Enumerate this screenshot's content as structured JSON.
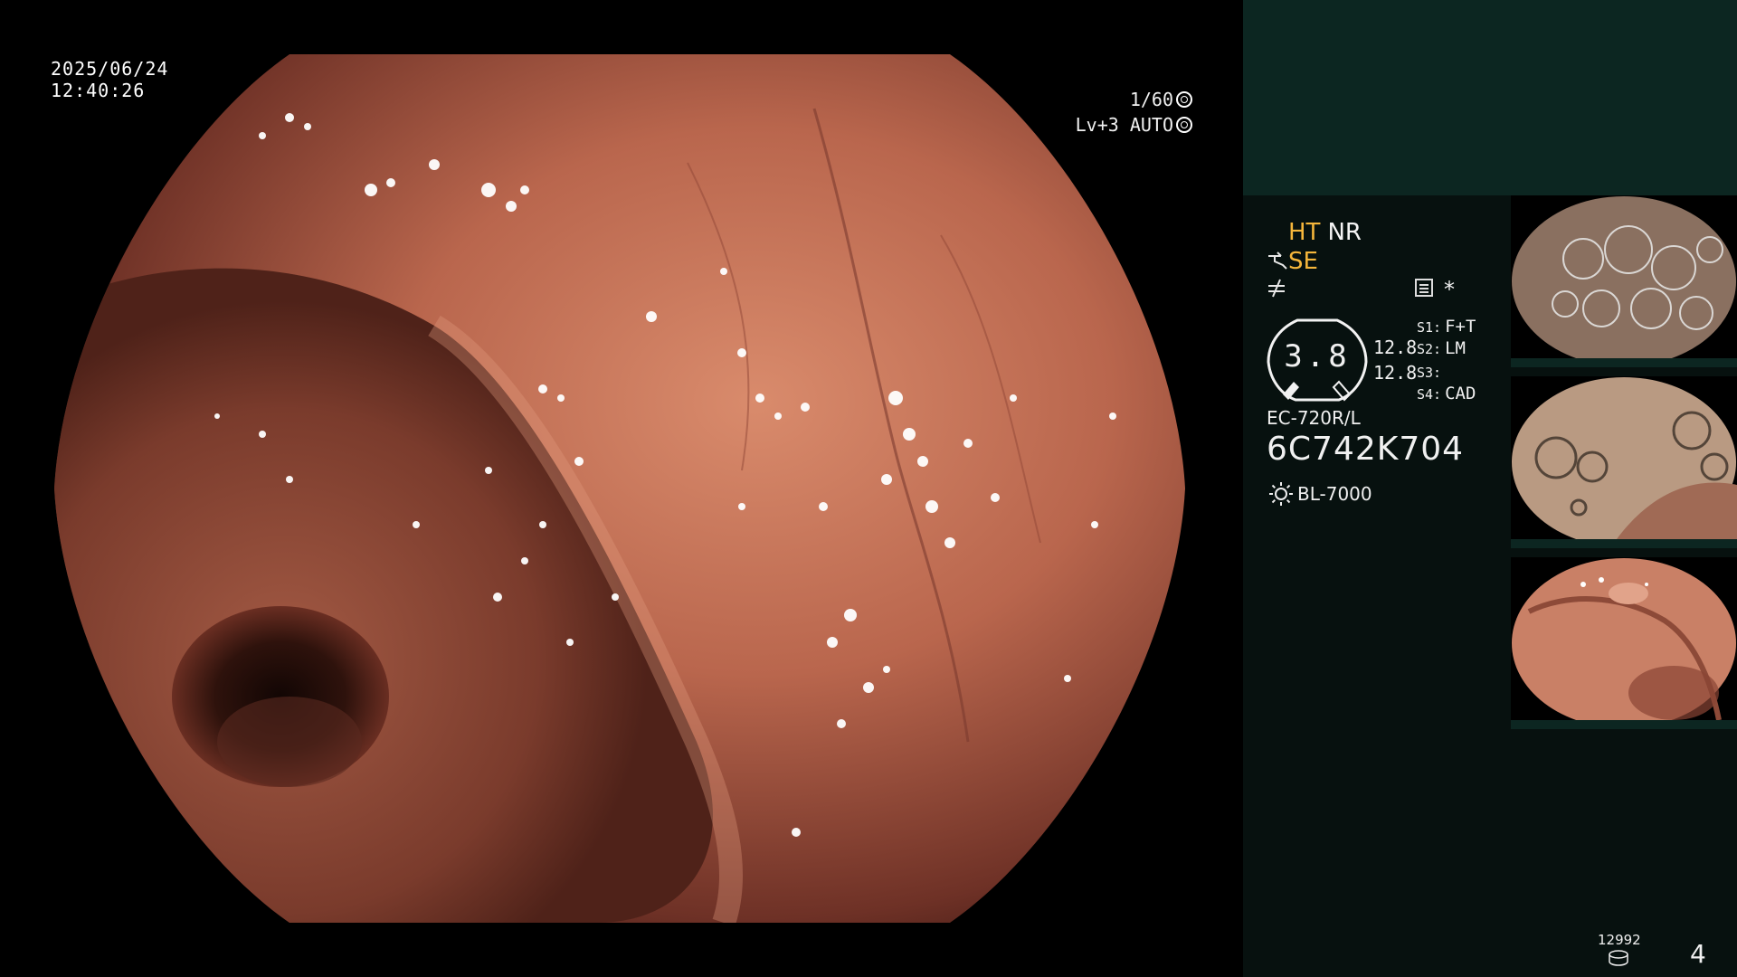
{
  "overlay": {
    "date": "2025/06/24",
    "time": "12:40:26",
    "shutter": "1/60",
    "level_auto": "Lv+3 AUTO"
  },
  "panel": {
    "ht": "HT",
    "nr": "NR",
    "se": "SE",
    "se_icon": "scope-hook-icon",
    "enhance_icon": "not-equal-icon",
    "asterisk": "*",
    "gauge_value": "3.8",
    "gauge_right_1": "12.8",
    "gauge_right_2": "12.8",
    "s1_key": "S1:",
    "s1_val": "F+T",
    "s2_key": "S2:",
    "s2_val": "LM",
    "s3_key": "S3:",
    "s3_val": "",
    "s4_key": "S4:",
    "s4_val": "CAD",
    "scope_model": "EC-720R/L",
    "scope_serial": "6C742K704",
    "light_source": "BL-7000",
    "storage_count": "12992",
    "page_number": "4"
  },
  "colors": {
    "panel_top": "#0c2621",
    "panel_bg": "#07110f",
    "accent_yellow": "#f5b63b"
  },
  "thumbnails": [
    "thumbnail-bubbles",
    "thumbnail-bubbles-fold",
    "thumbnail-colon-wall"
  ]
}
